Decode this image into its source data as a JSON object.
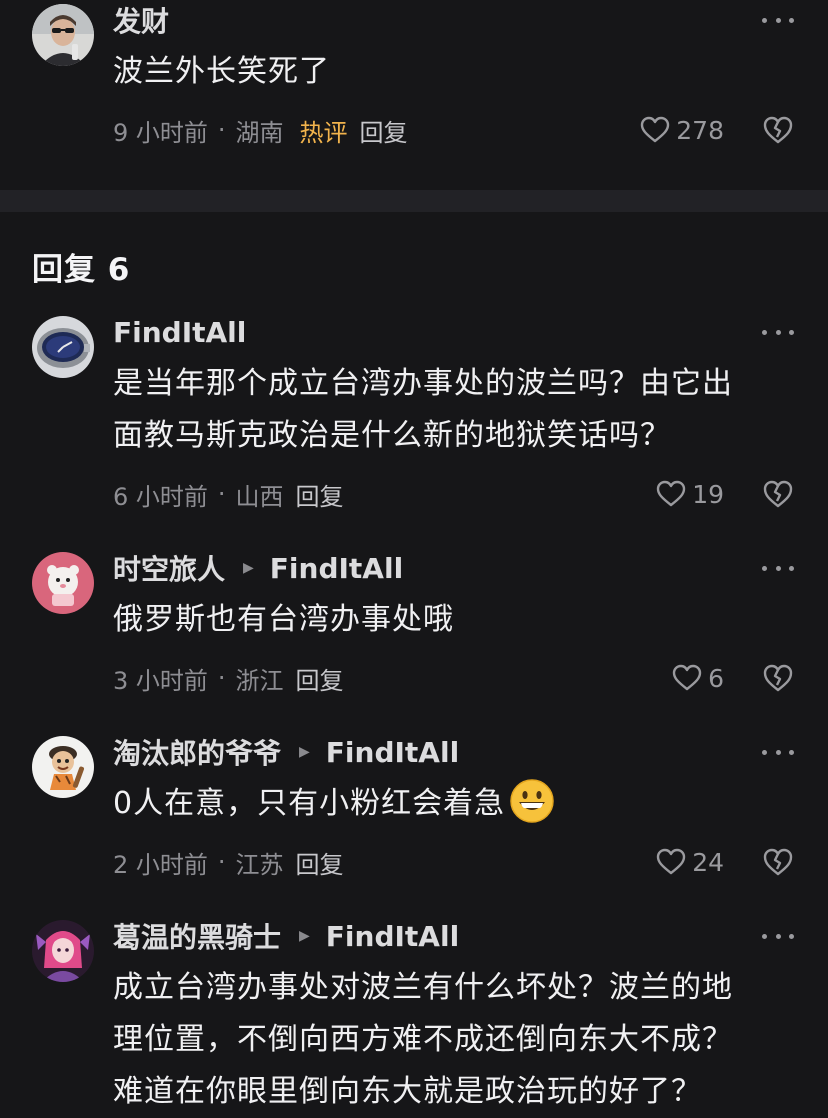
{
  "top_comment": {
    "author": "发财",
    "text": "波兰外长笑死了",
    "time": "9 小时前",
    "location": "湖南",
    "hot_badge": "热评",
    "reply_label": "回复",
    "likes": "278",
    "avatar_icon": "person-with-sunglasses-avatar"
  },
  "replies_header": {
    "label": "回复 6"
  },
  "replies": [
    {
      "author": "FindItAll",
      "reply_to": "",
      "lines": [
        "是当年那个成立台湾办事处的波兰吗？由它出",
        "面教马斯克政治是什么新的地狱笑话吗？"
      ],
      "time": "6 小时前",
      "location": "山西",
      "reply_label": "回复",
      "likes": "19",
      "avatar_icon": "watch-avatar"
    },
    {
      "author": "时空旅人",
      "reply_to": "FindItAll",
      "lines": [
        "俄罗斯也有台湾办事处哦"
      ],
      "time": "3 小时前",
      "location": "浙江",
      "reply_label": "回复",
      "likes": "6",
      "avatar_icon": "pink-bear-avatar"
    },
    {
      "author": "淘汰郎的爷爷",
      "reply_to": "FindItAll",
      "lines": [
        "0人在意，只有小粉红会着急"
      ],
      "time": "2 小时前",
      "location": "江苏",
      "reply_label": "回复",
      "likes": "24",
      "avatar_icon": "cartoon-caveman-avatar",
      "emoji": "grinning-face-emoji"
    },
    {
      "author": "葛温的黑骑士",
      "reply_to": "FindItAll",
      "lines": [
        "成立台湾办事处对波兰有什么坏处？波兰的地",
        "理位置，不倒向西方难不成还倒向东大不成？",
        "难道在你眼里倒向东大就是政治玩的好了？"
      ],
      "avatar_icon": "anime-girl-avatar"
    }
  ],
  "colors": {
    "background": "#161618",
    "divider": "#222226",
    "hot_badge": "#f1b34c",
    "meta_text": "#8e8e93"
  }
}
